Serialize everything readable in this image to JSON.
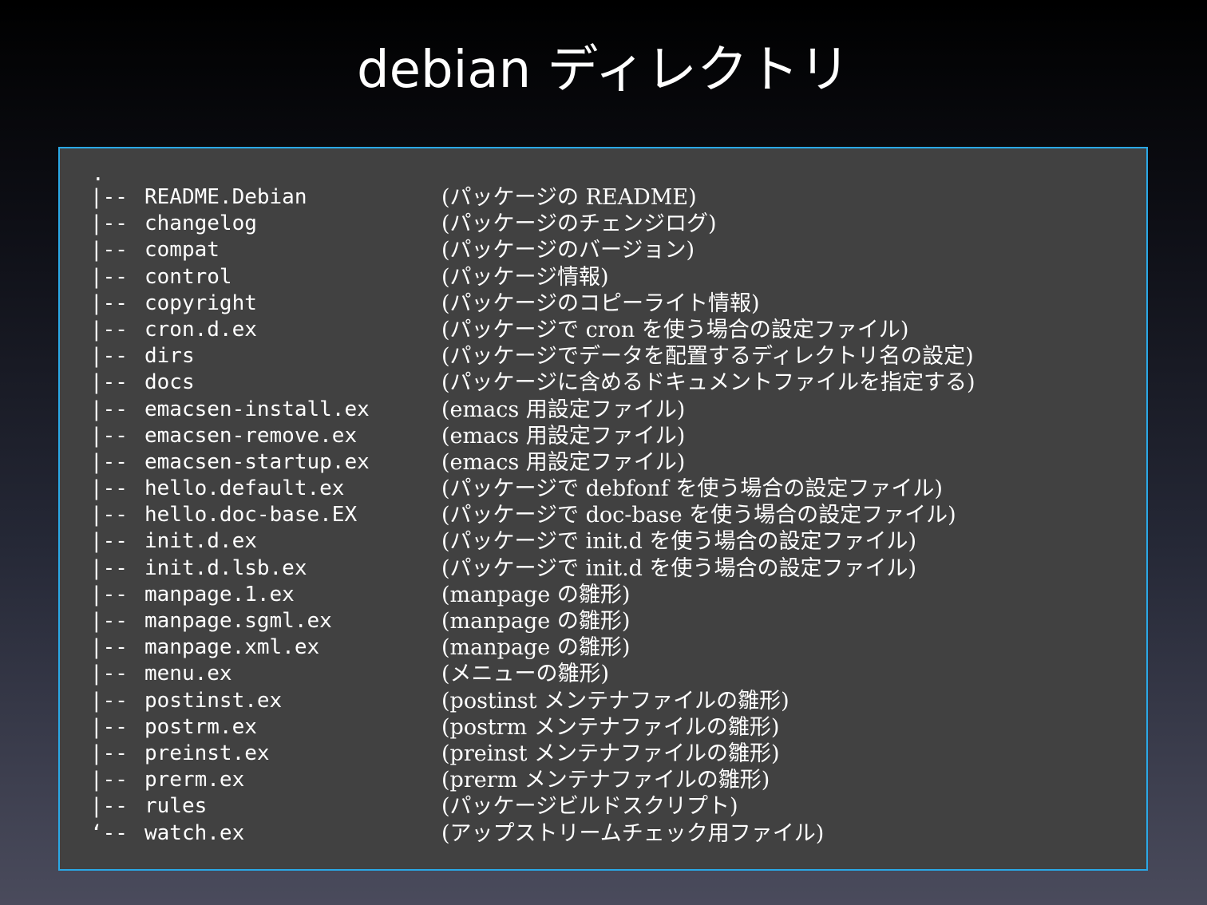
{
  "title": "debian ディレクトリ",
  "tree": {
    "root": ".",
    "items": [
      {
        "prefix": "|--",
        "name": "README.Debian",
        "desc": "(パッケージの README)"
      },
      {
        "prefix": "|--",
        "name": "changelog",
        "desc": "(パッケージのチェンジログ)"
      },
      {
        "prefix": "|--",
        "name": "compat",
        "desc": "(パッケージのバージョン)"
      },
      {
        "prefix": "|--",
        "name": "control",
        "desc": "(パッケージ情報)"
      },
      {
        "prefix": "|--",
        "name": "copyright",
        "desc": "(パッケージのコピーライト情報)"
      },
      {
        "prefix": "|--",
        "name": "cron.d.ex",
        "desc": "(パッケージで cron を使う場合の設定ファイル)"
      },
      {
        "prefix": "|--",
        "name": "dirs",
        "desc": "(パッケージでデータを配置するディレクトリ名の設定)"
      },
      {
        "prefix": "|--",
        "name": "docs",
        "desc": "(パッケージに含めるドキュメントファイルを指定する)"
      },
      {
        "prefix": "|--",
        "name": "emacsen-install.ex",
        "desc": "(emacs 用設定ファイル)"
      },
      {
        "prefix": "|--",
        "name": "emacsen-remove.ex",
        "desc": "(emacs 用設定ファイル)"
      },
      {
        "prefix": "|--",
        "name": "emacsen-startup.ex",
        "desc": "(emacs 用設定ファイル)"
      },
      {
        "prefix": "|--",
        "name": "hello.default.ex",
        "desc": "(パッケージで debfonf を使う場合の設定ファイル)"
      },
      {
        "prefix": "|--",
        "name": "hello.doc-base.EX",
        "desc": "(パッケージで doc-base を使う場合の設定ファイル)"
      },
      {
        "prefix": "|--",
        "name": "init.d.ex",
        "desc": "(パッケージで init.d を使う場合の設定ファイル)"
      },
      {
        "prefix": "|--",
        "name": "init.d.lsb.ex",
        "desc": "(パッケージで init.d を使う場合の設定ファイル)"
      },
      {
        "prefix": "|--",
        "name": "manpage.1.ex",
        "desc": "(manpage の雛形)"
      },
      {
        "prefix": "|--",
        "name": "manpage.sgml.ex",
        "desc": "(manpage の雛形)"
      },
      {
        "prefix": "|--",
        "name": "manpage.xml.ex",
        "desc": "(manpage の雛形)"
      },
      {
        "prefix": "|--",
        "name": "menu.ex",
        "desc": "(メニューの雛形)"
      },
      {
        "prefix": "|--",
        "name": "postinst.ex",
        "desc": "(postinst メンテナファイルの雛形)"
      },
      {
        "prefix": "|--",
        "name": "postrm.ex",
        "desc": "(postrm メンテナファイルの雛形)"
      },
      {
        "prefix": "|--",
        "name": "preinst.ex",
        "desc": "(preinst メンテナファイルの雛形)"
      },
      {
        "prefix": "|--",
        "name": "prerm.ex",
        "desc": "(prerm メンテナファイルの雛形)"
      },
      {
        "prefix": "|--",
        "name": "rules",
        "desc": "(パッケージビルドスクリプト)"
      },
      {
        "prefix": "‘--",
        "name": "watch.ex",
        "desc": "(アップストリームチェック用ファイル)"
      }
    ]
  },
  "colors": {
    "box_background": "#414141",
    "box_border": "#2aa8e6",
    "text": "#ffffff"
  }
}
